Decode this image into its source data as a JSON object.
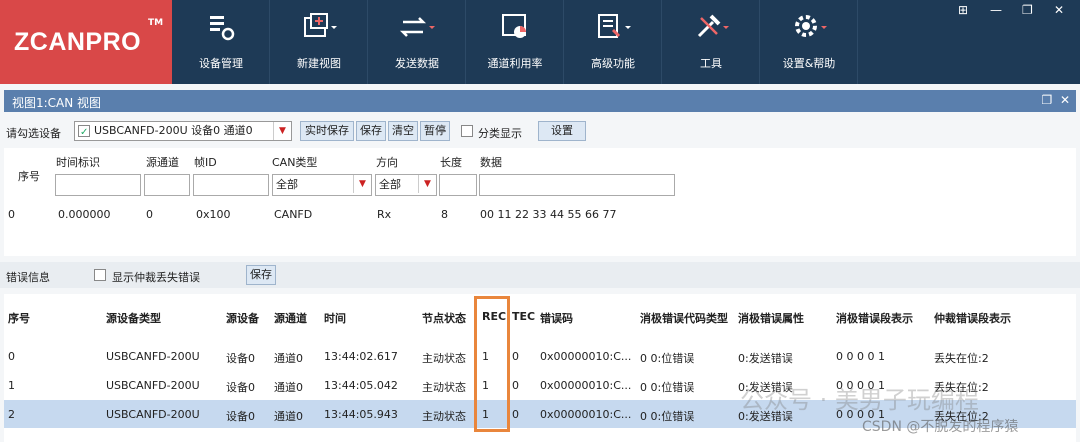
{
  "app": {
    "logo": "ZCANPRO",
    "tm": "TM"
  },
  "toolbar": [
    {
      "label": "设备管理",
      "icon": "device-manage-icon"
    },
    {
      "label": "新建视图",
      "icon": "new-view-icon"
    },
    {
      "label": "发送数据",
      "icon": "send-data-icon"
    },
    {
      "label": "通道利用率",
      "icon": "channel-usage-icon"
    },
    {
      "label": "高级功能",
      "icon": "advanced-icon"
    },
    {
      "label": "工具",
      "icon": "tools-icon"
    },
    {
      "label": "设置&帮助",
      "icon": "settings-help-icon"
    }
  ],
  "view": {
    "title": "视图1:CAN 视图"
  },
  "controls": {
    "select_device_label": "请勾选设备",
    "device_value": "USBCANFD-200U 设备0 通道0",
    "realtime_save": "实时保存",
    "save": "保存",
    "clear": "清空",
    "pause": "暂停",
    "classify_label": "分类显示",
    "settings": "设置"
  },
  "frame_table": {
    "headers": {
      "seq": "序号",
      "time": "时间标识",
      "src": "源通道",
      "id": "帧ID",
      "type": "CAN类型",
      "dir": "方向",
      "len": "长度",
      "data": "数据"
    },
    "filters": {
      "type": "全部",
      "dir": "全部"
    },
    "rows": [
      {
        "seq": "0",
        "time": "0.000000",
        "src": "0",
        "id": "0x100",
        "type": "CANFD",
        "dir": "Rx",
        "len": "8",
        "data": "00 11 22 33 44 55 66 77"
      }
    ]
  },
  "error_bar": {
    "label": "错误信息",
    "show_arb_label": "显示仲裁丢失错误",
    "save": "保存"
  },
  "error_table": {
    "headers": [
      "序号",
      "源设备类型",
      "源设备",
      "源通道",
      "时间",
      "节点状态",
      "REC",
      "TEC",
      "错误码",
      "消极错误代码类型",
      "消极错误属性",
      "消极错误段表示",
      "仲裁错误段表示"
    ],
    "rows": [
      {
        "seq": "0",
        "dev_type": "USBCANFD-200U",
        "dev": "设备0",
        "ch": "通道0",
        "time": "13:44:02.617",
        "state": "主动状态",
        "rec": "1",
        "tec": "0",
        "code": "0x00000010:C...",
        "pcode": "0 0:位错误",
        "pattr": "0:发送错误",
        "pseg": "0 0 0 0 1",
        "arb": "丢失在位:2"
      },
      {
        "seq": "1",
        "dev_type": "USBCANFD-200U",
        "dev": "设备0",
        "ch": "通道0",
        "time": "13:44:05.042",
        "state": "主动状态",
        "rec": "1",
        "tec": "0",
        "code": "0x00000010:C...",
        "pcode": "0 0:位错误",
        "pattr": "0:发送错误",
        "pseg": "0 0 0 0 1",
        "arb": "丢失在位:2"
      },
      {
        "seq": "2",
        "dev_type": "USBCANFD-200U",
        "dev": "设备0",
        "ch": "通道0",
        "time": "13:44:05.943",
        "state": "主动状态",
        "rec": "1",
        "tec": "0",
        "code": "0x00000010:C...",
        "pcode": "0 0:位错误",
        "pattr": "0:发送错误",
        "pseg": "0 0 0 0 1",
        "arb": "丢失在位:2"
      }
    ]
  },
  "watermark": {
    "wechat": "公众号 · 美男子玩编程",
    "csdn": "CSDN @不脱发的程序猿"
  },
  "colors": {
    "topbar": "#1e3a56",
    "logo_bg": "#d94848",
    "titlebar": "#5a7fad",
    "highlight": "#e9863c",
    "selected_row": "#c6d9ef"
  }
}
